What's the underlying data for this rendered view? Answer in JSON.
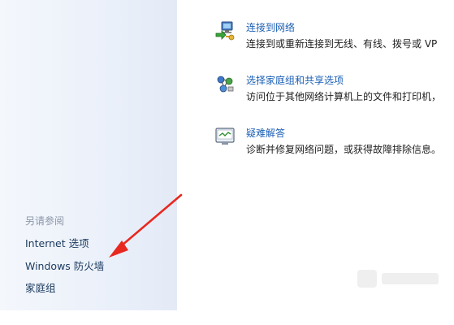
{
  "left_pane": {
    "see_also_header": "另请参阅",
    "links": [
      {
        "label": "Internet 选项"
      },
      {
        "label": "Windows 防火墙"
      },
      {
        "label": "家庭组"
      }
    ]
  },
  "tasks": [
    {
      "icon": "network-connect-icon",
      "title": "连接到网络",
      "description": "连接到或重新连接到无线、有线、拨号或 VP"
    },
    {
      "icon": "homegroup-sharing-icon",
      "title": "选择家庭组和共享选项",
      "description": "访问位于其他网络计算机上的文件和打印机，"
    },
    {
      "icon": "troubleshoot-icon",
      "title": "疑难解答",
      "description": "诊断并修复网络问题，或获得故障排除信息。"
    }
  ],
  "annotation": {
    "arrow_color": "#e8281f"
  }
}
